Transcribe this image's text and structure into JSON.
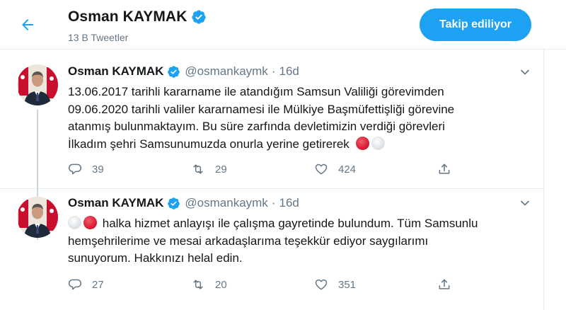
{
  "header": {
    "name": "Osman KAYMAK",
    "tweet_count": "13 B Tweetler",
    "follow_label": "Takip ediliyor"
  },
  "colors": {
    "accent": "#1da1f2",
    "text": "#14171a",
    "muted": "#657786",
    "divider": "#e6ecf0"
  },
  "icons": {
    "back": "arrow-left-icon",
    "verified": "verified-badge-icon",
    "more": "chevron-down-icon",
    "reply": "reply-icon",
    "retweet": "retweet-icon",
    "like": "heart-icon",
    "share": "share-icon"
  },
  "tweets": [
    {
      "name": "Osman KAYMAK",
      "handle": "@osmankaymk",
      "dot": "·",
      "time": "16d",
      "lines": [
        "13.06.2017 tarihli kararname ile atandığım Samsun Valiliği görevimden",
        "09.06.2020 tarihli valiler kararnamesi  ile Mülkiye Başmüfettişliği görevine",
        "atanmış bulunmaktayım. Bu süre zarfında devletimizin verdiği görevleri",
        "İlkadım şehri Samsunumuzda onurla yerine getirerek"
      ],
      "emojis_after": [
        "red-circle",
        "white-circle"
      ],
      "replies": "39",
      "retweets": "29",
      "likes": "424"
    },
    {
      "name": "Osman KAYMAK",
      "handle": "@osmankaymk",
      "dot": "·",
      "time": "16d",
      "emojis_before": [
        "white-circle",
        "red-circle"
      ],
      "lines": [
        "halka hizmet anlayışı ile çalışma gayretinde bulundum. Tüm Samsunlu",
        "hemşehrilerime ve mesai arkadaşlarıma teşekkür ediyor saygılarımı",
        "sunuyorum. Hakkınızı helal edin."
      ],
      "replies": "27",
      "retweets": "20",
      "likes": "351"
    }
  ]
}
